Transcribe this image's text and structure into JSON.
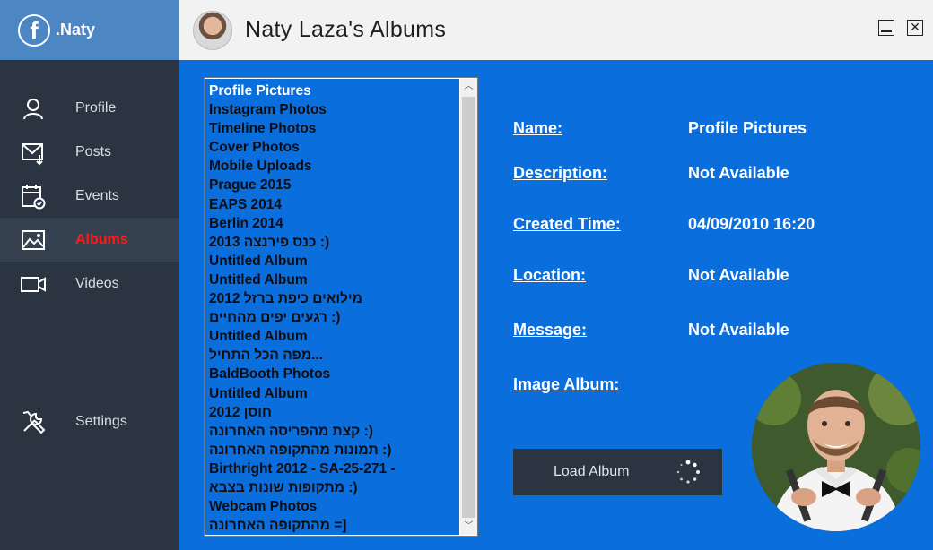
{
  "brand": {
    "name": ".Naty",
    "logo_glyph": "f"
  },
  "sidebar": {
    "items": [
      {
        "label": "Profile",
        "icon": "profile-icon",
        "active": false
      },
      {
        "label": "Posts",
        "icon": "posts-icon",
        "active": false
      },
      {
        "label": "Events",
        "icon": "events-icon",
        "active": false
      },
      {
        "label": "Albums",
        "icon": "albums-icon",
        "active": true
      },
      {
        "label": "Videos",
        "icon": "videos-icon",
        "active": false
      }
    ],
    "settings_label": "Settings"
  },
  "header": {
    "title": "Naty Laza's Albums"
  },
  "albums": [
    "Profile Pictures",
    "Instagram Photos",
    "Timeline Photos",
    "Cover Photos",
    "Mobile Uploads",
    "Prague 2015",
    "EAPS 2014",
    "Berlin 2014",
    "2013 כנס פירנצה :)",
    "Untitled Album",
    "Untitled Album",
    "מילואים כיפת ברזל 2012",
    "רגעים יפים מהחיים :)",
    "Untitled Album",
    "מפה הכל התחיל...",
    "BaldBooth Photos",
    "Untitled Album",
    "2012 חוסן",
    "קצת מהפריסה האחרונה :)",
    "תמונות מהתקופה האחרונה :)",
    "Birthright 2012 -  SA-25-271 -",
    "מתקופות שונות בצבא :)",
    "Webcam Photos",
    "מהתקופה האחרונה =]"
  ],
  "selected_album_index": 0,
  "details": {
    "name_label": "Name:",
    "name_value": "Profile Pictures",
    "description_label": "Description:",
    "description_value": "Not Available",
    "created_label": "Created Time:",
    "created_value": "04/09/2010 16:20",
    "location_label": "Location:",
    "location_value": "Not Available",
    "message_label": "Message:",
    "message_value": "Not Available",
    "image_album_label": "Image Album:"
  },
  "load_button": {
    "label": "Load Album"
  },
  "colors": {
    "sidebar": "#2b3542",
    "brand_bar": "#4c86c3",
    "main": "#0a6fdc",
    "active_label": "#ff1b1b"
  }
}
